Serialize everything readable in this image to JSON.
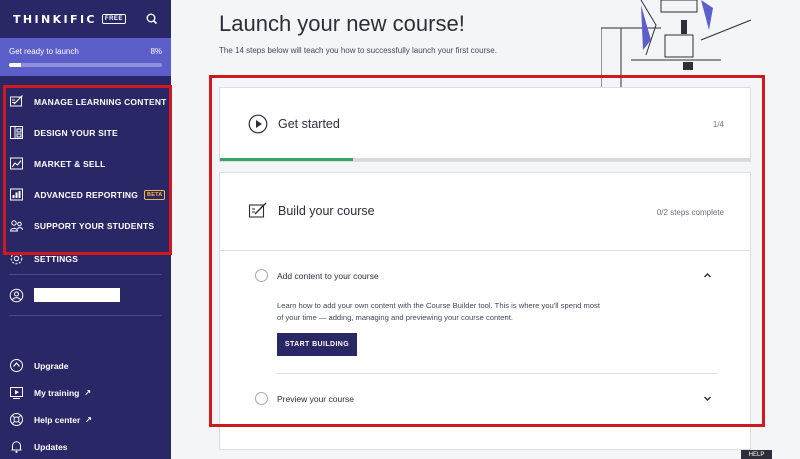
{
  "brand": {
    "name": "THINKIFIC",
    "badge": "FREE"
  },
  "launch": {
    "label": "Get ready to launch",
    "percent_text": "8%",
    "progress": 0.08
  },
  "nav": {
    "items": [
      {
        "label": "MANAGE LEARNING CONTENT",
        "icon": "edit-content-icon"
      },
      {
        "label": "DESIGN YOUR SITE",
        "icon": "layout-icon"
      },
      {
        "label": "MARKET & SELL",
        "icon": "chart-icon"
      },
      {
        "label": "ADVANCED REPORTING",
        "icon": "report-icon",
        "badge": "BETA"
      },
      {
        "label": "SUPPORT YOUR STUDENTS",
        "icon": "students-icon"
      }
    ],
    "settings": "SETTINGS"
  },
  "bottom_nav": [
    {
      "label": "Upgrade"
    },
    {
      "label": "My training",
      "external": "↗"
    },
    {
      "label": "Help center",
      "external": "↗"
    },
    {
      "label": "Updates"
    }
  ],
  "main": {
    "title": "Launch your new course!",
    "subtitle": "The 14 steps below will teach you how to successfully launch your first course."
  },
  "card_get_started": {
    "title": "Get started",
    "counter": "1/4",
    "progress": 0.25
  },
  "card_build": {
    "title": "Build your course",
    "counter": "0/2  steps complete",
    "steps": [
      {
        "label": "Add content to your course"
      },
      {
        "label": "Preview your course"
      }
    ],
    "description": "Learn how to add your own content with the Course Builder tool. This is where you'll spend most of your time — adding, managing and previewing your course content.",
    "cta": "START BUILDING"
  },
  "help_tab": "HELP",
  "colors": {
    "sidebar": "#2a2766",
    "accent": "#5c5ec9",
    "highlight": "#d0181f",
    "progress_green": "#3aa564"
  }
}
